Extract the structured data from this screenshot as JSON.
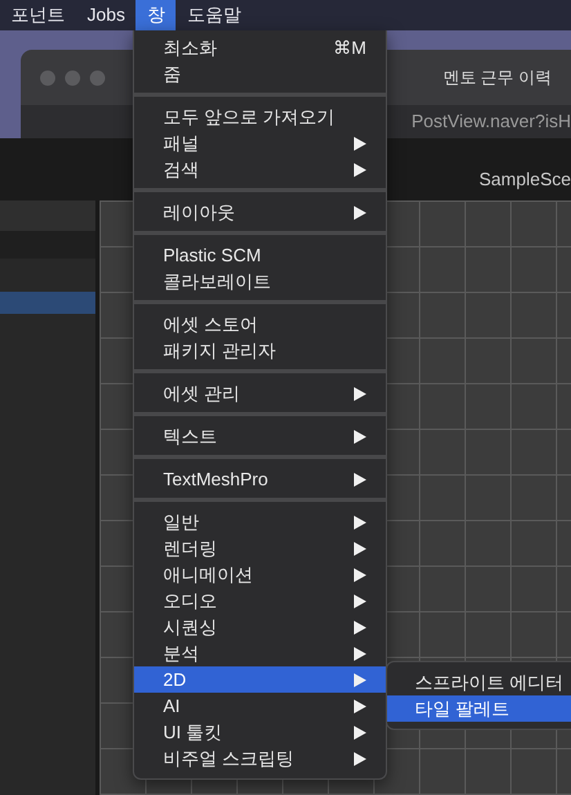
{
  "menubar": [
    {
      "label": "포넌트",
      "selected": false
    },
    {
      "label": "Jobs",
      "selected": false
    },
    {
      "label": "창",
      "selected": true
    },
    {
      "label": "도움말",
      "selected": false
    }
  ],
  "background": {
    "browser_tab": "멘토 근무 이력",
    "browser_url": "PostView.naver?isH",
    "scene_tab": "SampleSce"
  },
  "menu": {
    "sections": [
      {
        "items": [
          {
            "label": "최소화",
            "shortcut": "⌘M",
            "submenu": false,
            "selected": false
          },
          {
            "label": "줌",
            "submenu": false,
            "selected": false
          }
        ]
      },
      {
        "items": [
          {
            "label": "모두 앞으로 가져오기",
            "submenu": false,
            "selected": false
          },
          {
            "label": "패널",
            "submenu": true,
            "selected": false
          },
          {
            "label": "검색",
            "submenu": true,
            "selected": false
          }
        ]
      },
      {
        "items": [
          {
            "label": "레이아웃",
            "submenu": true,
            "selected": false
          }
        ]
      },
      {
        "items": [
          {
            "label": "Plastic SCM",
            "submenu": false,
            "selected": false
          },
          {
            "label": "콜라보레이트",
            "submenu": false,
            "selected": false
          }
        ]
      },
      {
        "items": [
          {
            "label": "에셋 스토어",
            "submenu": false,
            "selected": false
          },
          {
            "label": "패키지 관리자",
            "submenu": false,
            "selected": false
          }
        ]
      },
      {
        "items": [
          {
            "label": "에셋 관리",
            "submenu": true,
            "selected": false
          }
        ]
      },
      {
        "items": [
          {
            "label": "텍스트",
            "submenu": true,
            "selected": false
          }
        ]
      },
      {
        "items": [
          {
            "label": "TextMeshPro",
            "submenu": true,
            "selected": false
          }
        ]
      },
      {
        "items": [
          {
            "label": "일반",
            "submenu": true,
            "selected": false
          },
          {
            "label": "렌더링",
            "submenu": true,
            "selected": false
          },
          {
            "label": "애니메이션",
            "submenu": true,
            "selected": false
          },
          {
            "label": "오디오",
            "submenu": true,
            "selected": false
          },
          {
            "label": "시퀀싱",
            "submenu": true,
            "selected": false
          },
          {
            "label": "분석",
            "submenu": true,
            "selected": false
          },
          {
            "label": "2D",
            "submenu": true,
            "selected": true
          },
          {
            "label": "AI",
            "submenu": true,
            "selected": false
          },
          {
            "label": "UI 툴킷",
            "submenu": true,
            "selected": false
          },
          {
            "label": "비주얼 스크립팅",
            "submenu": true,
            "selected": false
          }
        ]
      }
    ]
  },
  "submenu": {
    "items": [
      {
        "label": "스프라이트 에디터",
        "selected": false
      },
      {
        "label": "타일 팔레트",
        "selected": true
      }
    ]
  }
}
